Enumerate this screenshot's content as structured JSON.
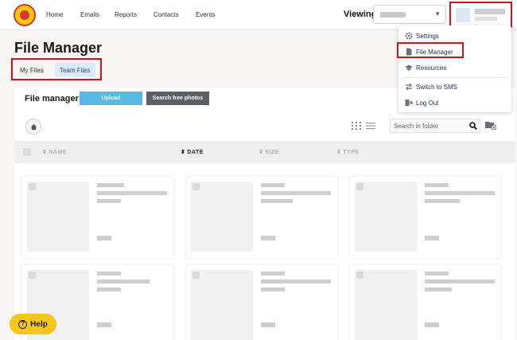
{
  "nav": {
    "links": [
      "Home",
      "Emails",
      "Reports",
      "Contacts",
      "Events"
    ],
    "viewing_label": "Viewing"
  },
  "page": {
    "title": "File Manager"
  },
  "tabs": [
    {
      "label": "My Files",
      "active": false
    },
    {
      "label": "Team Files",
      "active": true
    }
  ],
  "file_manager": {
    "title": "File manager",
    "upload_label": "Upload",
    "search_photos_label": "Search free photos",
    "search_placeholder": "Search in folder"
  },
  "table": {
    "columns": [
      {
        "label": "NAME",
        "active": false
      },
      {
        "label": "DATE",
        "active": true
      },
      {
        "label": "SIZE",
        "active": false
      },
      {
        "label": "TYPE",
        "active": false
      }
    ]
  },
  "user_menu": {
    "items": [
      {
        "label": "Settings",
        "icon": "gear-icon"
      },
      {
        "label": "File Manager",
        "icon": "file-icon"
      },
      {
        "label": "Resources",
        "icon": "graduation-cap-icon"
      },
      {
        "label": "Switch to SMS",
        "icon": "switch-icon"
      },
      {
        "label": "Log Out",
        "icon": "logout-icon"
      }
    ]
  },
  "help": {
    "label": "Help"
  },
  "colors": {
    "accent_blue": "#58b9e8",
    "highlight_red": "#d0121b",
    "help_yellow": "#f6c61f"
  }
}
